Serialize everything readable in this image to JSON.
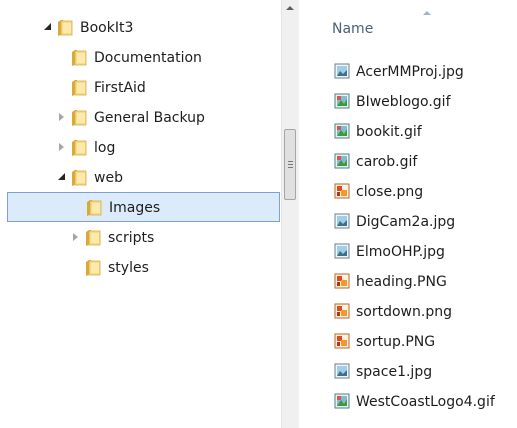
{
  "tree": {
    "items": [
      {
        "label": "BookIt3",
        "state": "expanded",
        "depth": 0,
        "selected": false
      },
      {
        "label": "Documentation",
        "state": "none",
        "depth": 1,
        "selected": false
      },
      {
        "label": "FirstAid",
        "state": "none",
        "depth": 1,
        "selected": false
      },
      {
        "label": "General Backup",
        "state": "collapsed",
        "depth": 1,
        "selected": false
      },
      {
        "label": "log",
        "state": "collapsed",
        "depth": 1,
        "selected": false
      },
      {
        "label": "web",
        "state": "expanded",
        "depth": 1,
        "selected": false
      },
      {
        "label": "Images",
        "state": "none",
        "depth": 2,
        "selected": true
      },
      {
        "label": "scripts",
        "state": "collapsed",
        "depth": 2,
        "selected": false
      },
      {
        "label": "styles",
        "state": "none",
        "depth": 2,
        "selected": false
      }
    ]
  },
  "file_list": {
    "column_header": "Name",
    "sort": "ascending",
    "files": [
      {
        "name": "AcerMMProj.jpg",
        "icon": "jpg-image-icon"
      },
      {
        "name": "BIweblogo.gif",
        "icon": "gif-image-icon"
      },
      {
        "name": "bookit.gif",
        "icon": "gif-image-icon"
      },
      {
        "name": "carob.gif",
        "icon": "gif-image-icon"
      },
      {
        "name": "close.png",
        "icon": "png-image-icon"
      },
      {
        "name": "DigCam2a.jpg",
        "icon": "jpg-image-icon"
      },
      {
        "name": "ElmoOHP.jpg",
        "icon": "jpg-image-icon"
      },
      {
        "name": "heading.PNG",
        "icon": "png-image-icon"
      },
      {
        "name": "sortdown.png",
        "icon": "png-image-icon"
      },
      {
        "name": "sortup.PNG",
        "icon": "png-image-icon"
      },
      {
        "name": "space1.jpg",
        "icon": "jpg-image-icon"
      },
      {
        "name": "WestCoastLogo4.gif",
        "icon": "gif-image-icon"
      }
    ]
  },
  "colors": {
    "selection_fill": "#dcebfc",
    "selection_border": "#7da2ce",
    "header_text": "#4c607a",
    "folder_yellow": "#f5d77a"
  }
}
